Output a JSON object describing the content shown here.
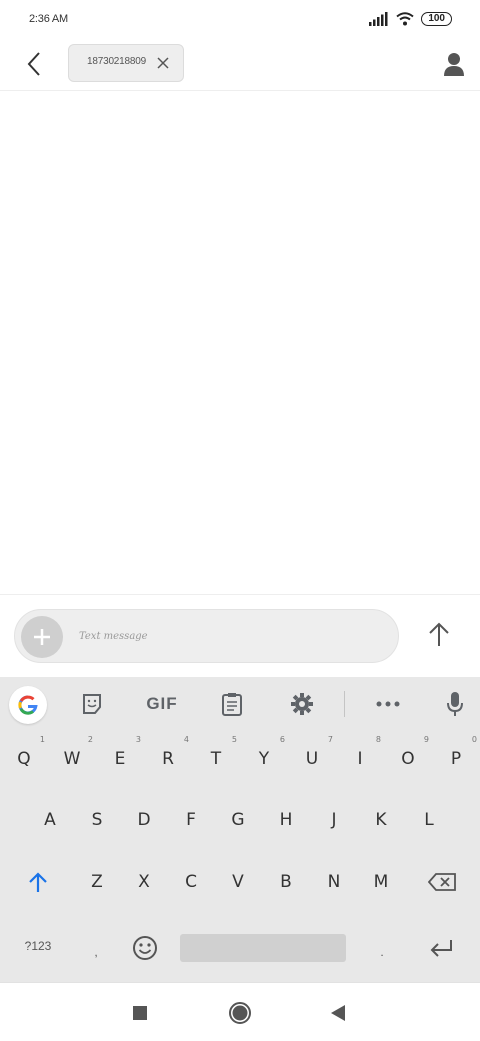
{
  "status_bar": {
    "time": "2:36 AM",
    "battery": "100"
  },
  "header": {
    "recipient": "18730218809",
    "icons": {
      "back": "chevron-left-icon",
      "remove": "close-icon",
      "contact": "person-icon"
    }
  },
  "compose": {
    "placeholder": "Text message",
    "value": "",
    "icons": {
      "attach": "plus-icon",
      "send": "arrow-up-icon"
    }
  },
  "keyboard": {
    "toolbar": {
      "items": [
        "google-icon",
        "sticker-icon",
        "gif",
        "clipboard-icon",
        "gear-icon",
        "more-icon",
        "microphone-icon"
      ],
      "gif_label": "GIF"
    },
    "row1": [
      {
        "key": "Q",
        "hint": "1"
      },
      {
        "key": "W",
        "hint": "2"
      },
      {
        "key": "E",
        "hint": "3"
      },
      {
        "key": "R",
        "hint": "4"
      },
      {
        "key": "T",
        "hint": "5"
      },
      {
        "key": "Y",
        "hint": "6"
      },
      {
        "key": "U",
        "hint": "7"
      },
      {
        "key": "I",
        "hint": "8"
      },
      {
        "key": "O",
        "hint": "9"
      },
      {
        "key": "P",
        "hint": "0"
      }
    ],
    "row2": [
      "A",
      "S",
      "D",
      "F",
      "G",
      "H",
      "J",
      "K",
      "L"
    ],
    "row3": [
      "Z",
      "X",
      "C",
      "V",
      "B",
      "N",
      "M"
    ],
    "row4": {
      "symbols_label": "?123",
      "comma": ",",
      "period": "."
    }
  },
  "accent_color": "#1a73e8"
}
